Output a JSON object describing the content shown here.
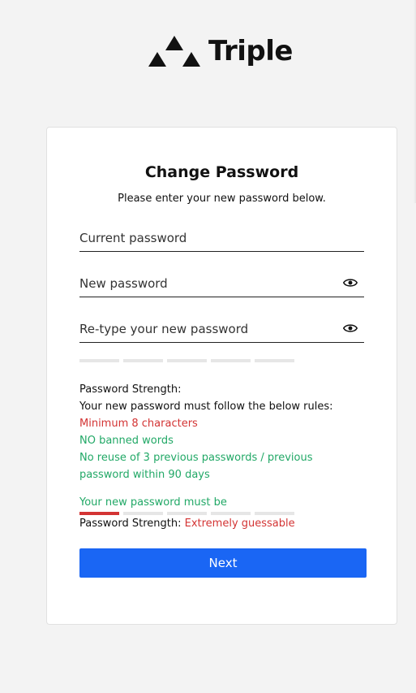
{
  "brand": {
    "name": "Triple"
  },
  "form": {
    "title": "Change Password",
    "subtitle": "Please enter your new password below.",
    "fields": [
      {
        "placeholder": "Current password",
        "value": ""
      },
      {
        "placeholder": "New password",
        "value": ""
      },
      {
        "placeholder": "Re-type your new password",
        "value": ""
      }
    ],
    "rules": {
      "heading": "Password Strength:",
      "intro": "Your new password must follow the below rules:",
      "items": [
        {
          "text": "Minimum 8 characters",
          "status": "fail"
        },
        {
          "text": "NO banned words",
          "status": "pass"
        },
        {
          "text": "No reuse of 3 previous passwords / previous password within 90 days",
          "status": "pass"
        }
      ]
    },
    "warning": "Your new password must be",
    "strength": {
      "label": "Password Strength: ",
      "value": "Extremely guessable",
      "level": 1,
      "max": 5
    },
    "submit_label": "Next"
  },
  "colors": {
    "accent": "#1a66f4",
    "fail": "#d33434",
    "pass": "#21a866"
  },
  "icons": {
    "visibility": "eye-icon",
    "logo": "triangles-logo-icon"
  }
}
